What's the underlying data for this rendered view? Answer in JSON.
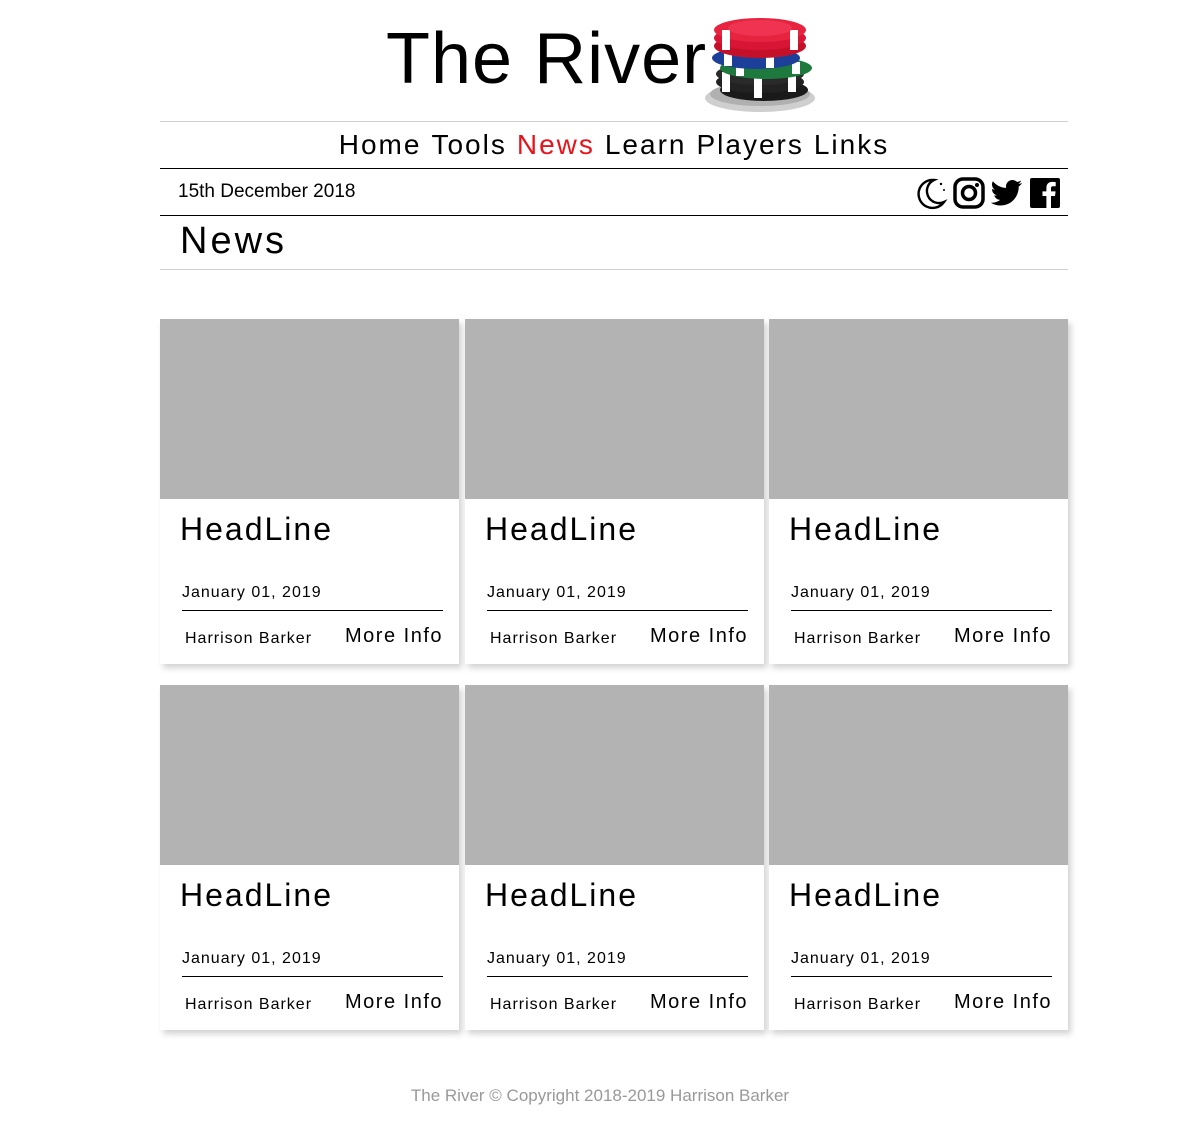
{
  "site": {
    "title": "The River"
  },
  "nav": [
    "Home",
    "Tools",
    "News",
    "Learn",
    "Players",
    "Links"
  ],
  "nav_active": "News",
  "date_bar": {
    "date": "15th December 2018"
  },
  "icons": [
    "moon-icon",
    "instagram-icon",
    "twitter-icon",
    "facebook-icon"
  ],
  "page": {
    "section_title": "News"
  },
  "cards": [
    {
      "headline": "HeadLine",
      "date": "January 01, 2019",
      "author": "Harrison Barker",
      "more": "More Info"
    },
    {
      "headline": "HeadLine",
      "date": "January 01, 2019",
      "author": "Harrison Barker",
      "more": "More Info"
    },
    {
      "headline": "HeadLine",
      "date": "January 01, 2019",
      "author": "Harrison Barker",
      "more": "More Info"
    },
    {
      "headline": "HeadLine",
      "date": "January 01, 2019",
      "author": "Harrison Barker",
      "more": "More Info"
    },
    {
      "headline": "HeadLine",
      "date": "January 01, 2019",
      "author": "Harrison Barker",
      "more": "More Info"
    },
    {
      "headline": "HeadLine",
      "date": "January 01, 2019",
      "author": "Harrison Barker",
      "more": "More Info"
    }
  ],
  "footer": {
    "text": "The River © Copyright 2018-2019 Harrison Barker"
  },
  "colors": {
    "accent": "#e8141c",
    "thumb": "#b3b3b3",
    "footer": "#999999"
  }
}
